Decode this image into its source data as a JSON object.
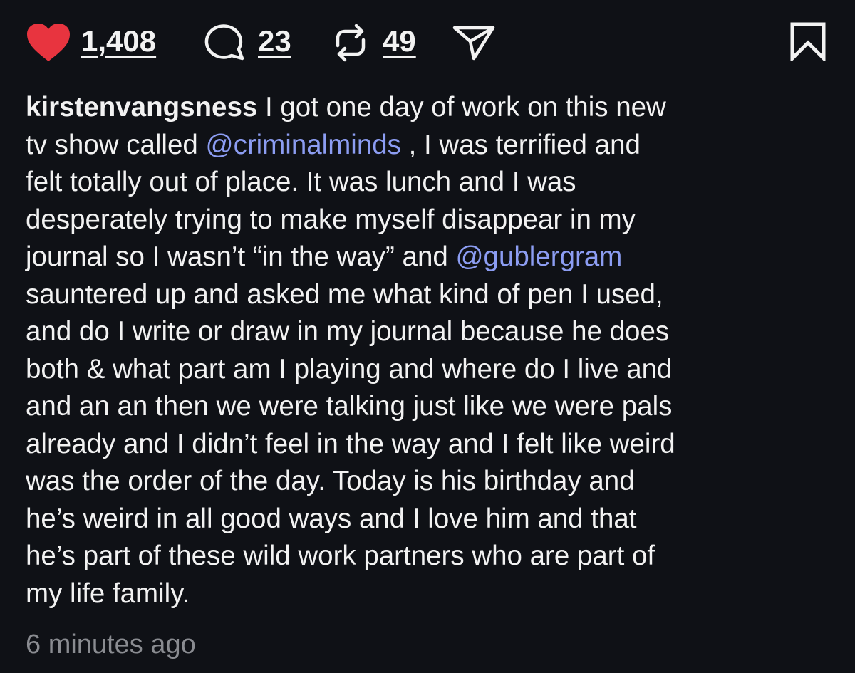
{
  "actions": {
    "like_count": "1,408",
    "comment_count": "23",
    "repost_count": "49",
    "like_color": "#e8343f",
    "icons": [
      "heart-icon",
      "comment-icon",
      "repost-icon",
      "share-icon",
      "bookmark-icon"
    ]
  },
  "caption": {
    "username": "kirstenvangsness",
    "line1_rest": " I got one day of work on this new",
    "line2_a": "tv show called ",
    "mention1": "@criminalminds",
    "line2_b": " , I was terrified and",
    "line3": "felt totally out of place. It was lunch and I was",
    "line4": "desperately trying to make myself disappear in my",
    "line5_a": "journal so I wasn’t “in the way” and ",
    "mention2": "@gublergram",
    "line6": "sauntered up and asked me what kind of pen I used,",
    "line7": "and do I write or draw in my journal because he does",
    "line8": "both & what part am I playing and where do I live and",
    "line9": "and an an then we were talking just like we were pals",
    "line10": "already and I didn’t feel in the way and I felt like weird",
    "line11": "was the order of the day. Today is his birthday and",
    "line12": "he’s weird in all good ways and I love him and that",
    "line13": "he’s part of these wild work partners who are part of",
    "line14": "my life family.",
    "mention_color": "#8c9df2"
  },
  "timestamp": "6 minutes ago"
}
